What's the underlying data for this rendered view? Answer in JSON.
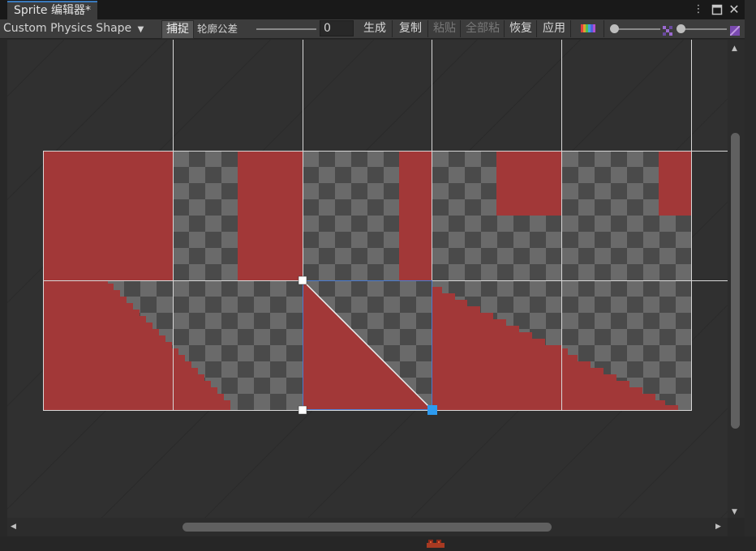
{
  "window": {
    "tab_title": "Sprite 编辑器*",
    "menu_icon": "kebab-menu-icon",
    "maximize_icon": "maximize-icon",
    "close_icon": "close-icon"
  },
  "toolbar": {
    "mode_dropdown": "Custom Physics Shape",
    "snap_label": "捕捉",
    "outline_tolerance_label": "轮廓公差",
    "outline_tolerance_value": "0",
    "generate_label": "生成",
    "copy_label": "复制",
    "paste_label": "粘贴",
    "paste_all_label": "全部粘贴",
    "revert_label": "恢复",
    "apply_label": "应用",
    "color_channel_icon": "rgb-channels-icon",
    "mip_icon": "mip-level-icon",
    "zoom_icon": "zoom-icon"
  },
  "colors": {
    "sprite_red": "#a23838",
    "checker_light": "#6a6a6a",
    "checker_dark": "#4a4a4a",
    "selection_blue": "#2d9bf0",
    "outline_white": "#e0e0e0"
  },
  "scrollbars": {
    "up_icon": "scroll-up-icon",
    "down_icon": "scroll-down-icon",
    "left_icon": "scroll-left-icon",
    "right_icon": "scroll-right-icon"
  }
}
